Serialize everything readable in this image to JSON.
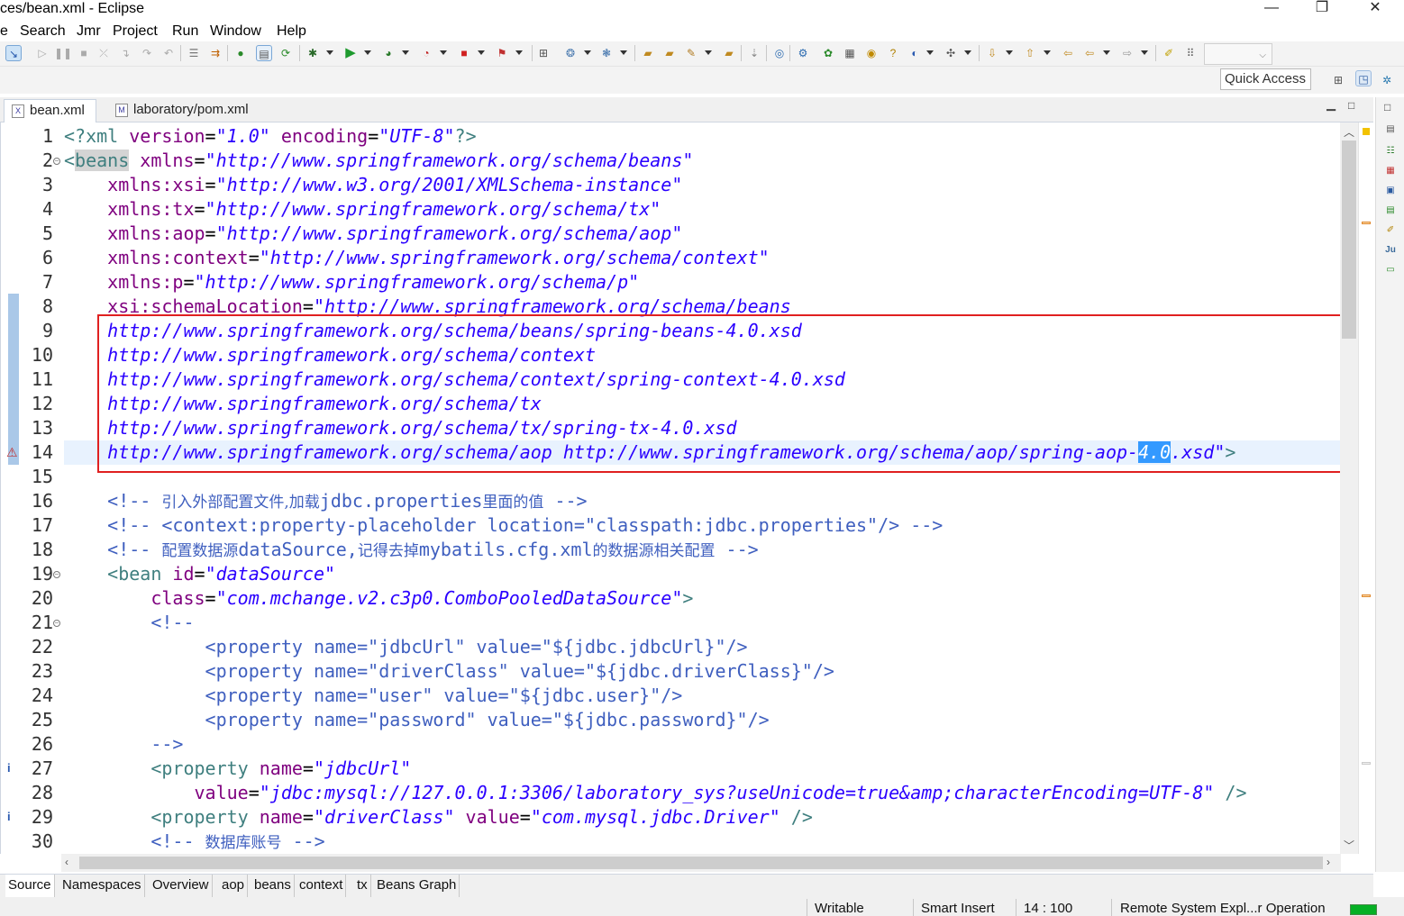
{
  "window": {
    "title": "ces/bean.xml - Eclipse",
    "minimize": "—",
    "maximize": "❐",
    "close": "✕"
  },
  "menu": [
    "e",
    "Search",
    "Jmr",
    "Project",
    "Run",
    "Window",
    "Help"
  ],
  "quick_access": {
    "placeholder": "Quick Access"
  },
  "tabs": [
    {
      "label": "bean.xml",
      "active": true,
      "close": "✕"
    },
    {
      "label": "laboratory/pom.xml",
      "active": false
    }
  ],
  "editor": {
    "line_numbers": [
      "1",
      "2",
      "3",
      "4",
      "5",
      "6",
      "7",
      "8",
      "9",
      "10",
      "11",
      "12",
      "13",
      "14",
      "15",
      "16",
      "17",
      "18",
      "19",
      "20",
      "21",
      "22",
      "23",
      "24",
      "25",
      "26",
      "27",
      "28",
      "29",
      "30"
    ],
    "lines": {
      "l1_a": "<?xml ",
      "l1_b": "version",
      "l1_c": "=",
      "l1_d": "\"1.0\"",
      "l1_e": " encoding",
      "l1_f": "=",
      "l1_g": "\"UTF-8\"",
      "l1_h": "?>",
      "l2_a": "<",
      "l2_b": "beans",
      "l2_c": " xmlns",
      "l2_d": "=",
      "l2_e": "\"http://www.springframework.org/schema/beans\"",
      "l3_a": "    xmlns:xsi",
      "l3_b": "=",
      "l3_c": "\"http://www.w3.org/2001/XMLSchema-instance\"",
      "l4_a": "    xmlns:tx",
      "l4_b": "=",
      "l4_c": "\"http://www.springframework.org/schema/tx\"",
      "l5_a": "    xmlns:aop",
      "l5_b": "=",
      "l5_c": "\"http://www.springframework.org/schema/aop\"",
      "l6_a": "    xmlns:context",
      "l6_b": "=",
      "l6_c": "\"http://www.springframework.org/schema/context\"",
      "l7_a": "    xmlns:p",
      "l7_b": "=",
      "l7_c": "\"http://www.springframework.org/schema/p\"",
      "l8_a": "    xsi:schemaLocation",
      "l8_b": "=",
      "l8_c": "\"http://www.springframework.org/schema/beans",
      "l9": "    http://www.springframework.org/schema/beans/spring-beans-4.0.xsd",
      "l10": "    http://www.springframework.org/schema/context",
      "l11": "    http://www.springframework.org/schema/context/spring-context-4.0.xsd",
      "l12": "    http://www.springframework.org/schema/tx",
      "l13": "    http://www.springframework.org/schema/tx/spring-tx-4.0.xsd",
      "l14_a": "    http://www.springframework.org/schema/aop http://www.springframework.org/schema/aop/spring-aop-",
      "l14_sel": "4.0",
      "l14_b": ".xsd\"",
      "l14_c": ">",
      "l16_a": "    <!-- ",
      "l16_b": "引入外部配置文件,加载",
      "l16_c": "jdbc.properties",
      "l16_d": "里面的值",
      "l16_e": " -->",
      "l17": "    <!-- <context:property-placeholder location=\"classpath:jdbc.properties\"/> -->",
      "l18_a": "    <!-- ",
      "l18_b": "配置数据源",
      "l18_c": "dataSource,",
      "l18_d": "记得去掉",
      "l18_e": "mybatils.cfg.xml",
      "l18_f": "的数据源相关配置",
      "l18_g": " -->",
      "l19_a": "    <",
      "l19_b": "bean",
      "l19_c": " id",
      "l19_d": "=",
      "l19_e": "\"dataSource\"",
      "l20_a": "        class",
      "l20_b": "=",
      "l20_c": "\"com.mchange.v2.c3p0.ComboPooledDataSource\"",
      "l20_d": ">",
      "l21": "        <!--",
      "l22": "             <property name=\"jdbcUrl\" value=\"${jdbc.jdbcUrl}\"/>",
      "l23": "             <property name=\"driverClass\" value=\"${jdbc.driverClass}\"/>",
      "l24": "             <property name=\"user\" value=\"${jdbc.user}\"/>",
      "l25": "             <property name=\"password\" value=\"${jdbc.password}\"/>",
      "l26": "        -->",
      "l27_a": "        <",
      "l27_b": "property",
      "l27_c": " name",
      "l27_d": "=",
      "l27_e": "\"jdbcUrl\"",
      "l28_a": "            value",
      "l28_b": "=",
      "l28_c": "\"jdbc:mysql://127.0.0.1:3306/laboratory_sys?useUnicode=true&amp;characterEncoding=UTF-8\"",
      "l28_d": " />",
      "l29_a": "        <",
      "l29_b": "property",
      "l29_c": " name",
      "l29_d": "=",
      "l29_e": "\"driverClass\"",
      "l29_f": " value",
      "l29_g": "=",
      "l29_h": "\"com.mysql.jdbc.Driver\"",
      "l29_i": " />",
      "l30_a": "        <!-- ",
      "l30_b": "数据库账号",
      "l30_c": " -->"
    }
  },
  "bottom_tabs": [
    "Source",
    "Namespaces",
    "Overview",
    "aop",
    "beans",
    "context",
    "tx",
    "Beans Graph"
  ],
  "status": {
    "writable": "Writable",
    "insert_mode": "Smart Insert",
    "position": "14 : 100",
    "operation": "Remote System Expl...r Operation"
  },
  "colors": {
    "tag": "#3f7f7f",
    "attribute": "#7f007f",
    "string": "#2a00ff",
    "comment": "#3f5fbf",
    "highlight_box": "#e02020",
    "selection": "#3399ff"
  }
}
